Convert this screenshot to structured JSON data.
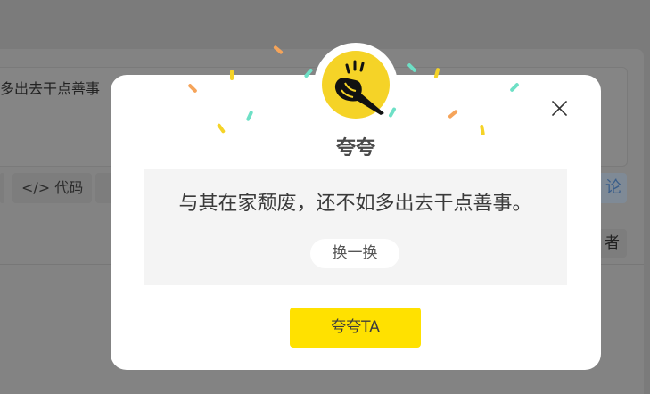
{
  "background": {
    "editor_text": "多出去干点善事",
    "toolbar": [
      {
        "label": "代码",
        "icon": "code-icon"
      }
    ],
    "right_button_label": "论",
    "right_button2_label": "者"
  },
  "modal": {
    "title": "夸夸",
    "badge_icon": "clapping-hands-icon",
    "quote": "与其在家颓废，还不如多出去干点善事。",
    "swap_label": "换一换",
    "praise_label": "夸夸TA",
    "close_icon": "close-icon",
    "colors": {
      "accent": "#ffe100",
      "badge": "#f5d327",
      "confetti": [
        "#f5d327",
        "#6ee0c6",
        "#f5a45a"
      ]
    }
  }
}
